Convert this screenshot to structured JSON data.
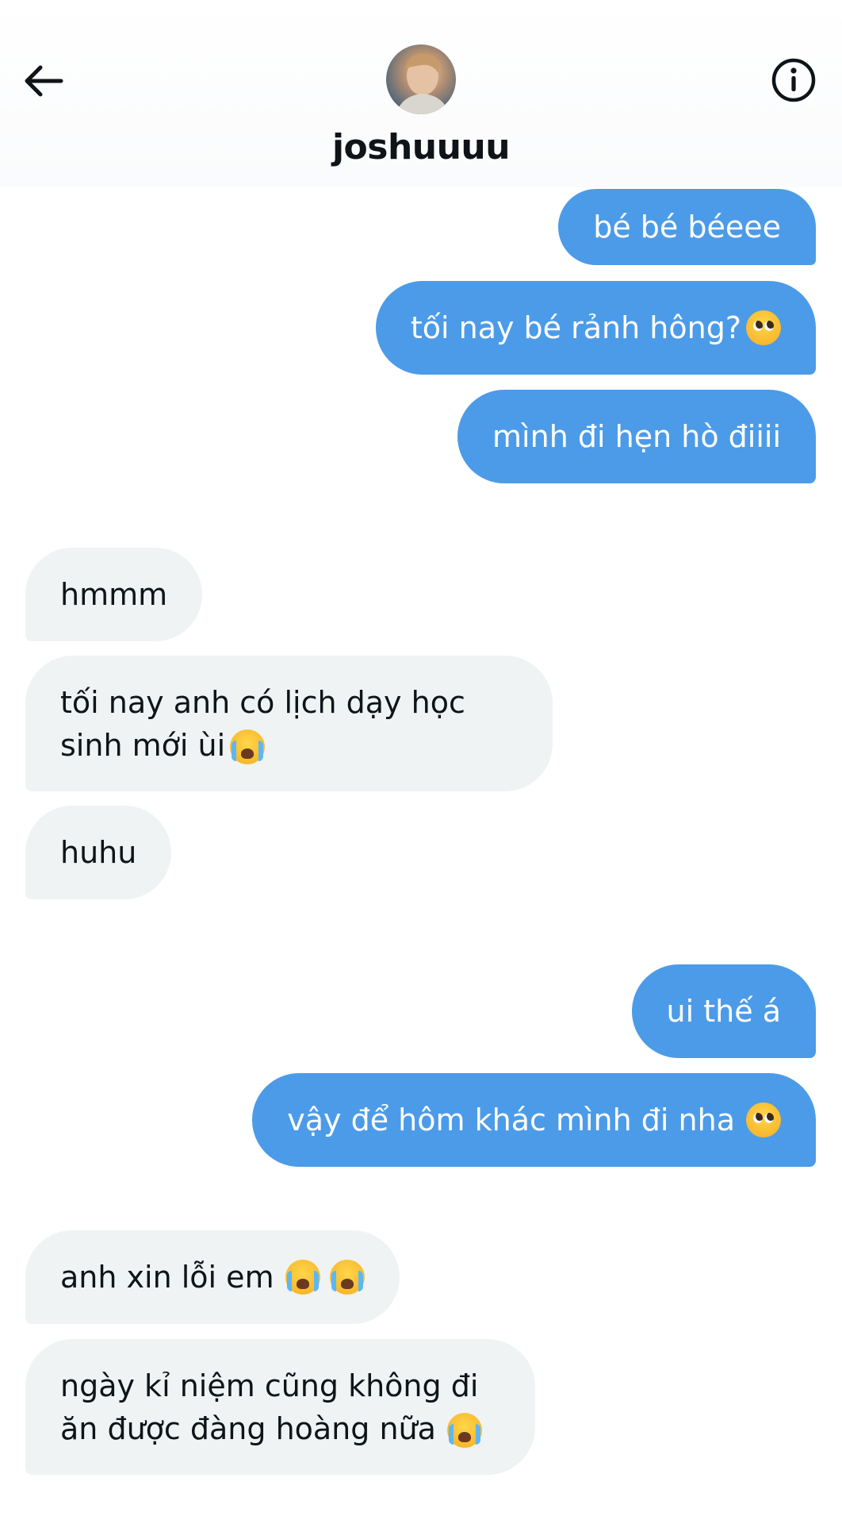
{
  "header": {
    "username": "joshuuuu",
    "back_icon": "arrow-left-icon",
    "info_icon": "info-icon"
  },
  "colors": {
    "sent_bubble": "#4c9be8",
    "received_bubble": "#eff3f4",
    "text": "#0f1419"
  },
  "messages": [
    {
      "from": "me",
      "text": "bé bé béeee",
      "emoji": ""
    },
    {
      "from": "me",
      "text": "tối nay bé rảnh hông?",
      "emoji": "pleading-face"
    },
    {
      "from": "me",
      "text": "mình đi hẹn hò điiii",
      "emoji": ""
    },
    {
      "from": "them",
      "text": "hmmm",
      "emoji": ""
    },
    {
      "from": "them",
      "text": "tối nay anh có lịch dạy học sinh mới ùi",
      "emoji": "crying-face"
    },
    {
      "from": "them",
      "text": "huhu",
      "emoji": ""
    },
    {
      "from": "me",
      "text": "ui thế á",
      "emoji": ""
    },
    {
      "from": "me",
      "text": "vậy để hôm khác mình đi nha",
      "emoji": "pleading-face"
    },
    {
      "from": "them",
      "text": "anh xin lỗi em",
      "emoji": "crying-face crying-face"
    },
    {
      "from": "them",
      "text": "ngày kỉ niệm cũng không đi ăn được đàng hoàng nữa",
      "emoji": "crying-face"
    }
  ]
}
